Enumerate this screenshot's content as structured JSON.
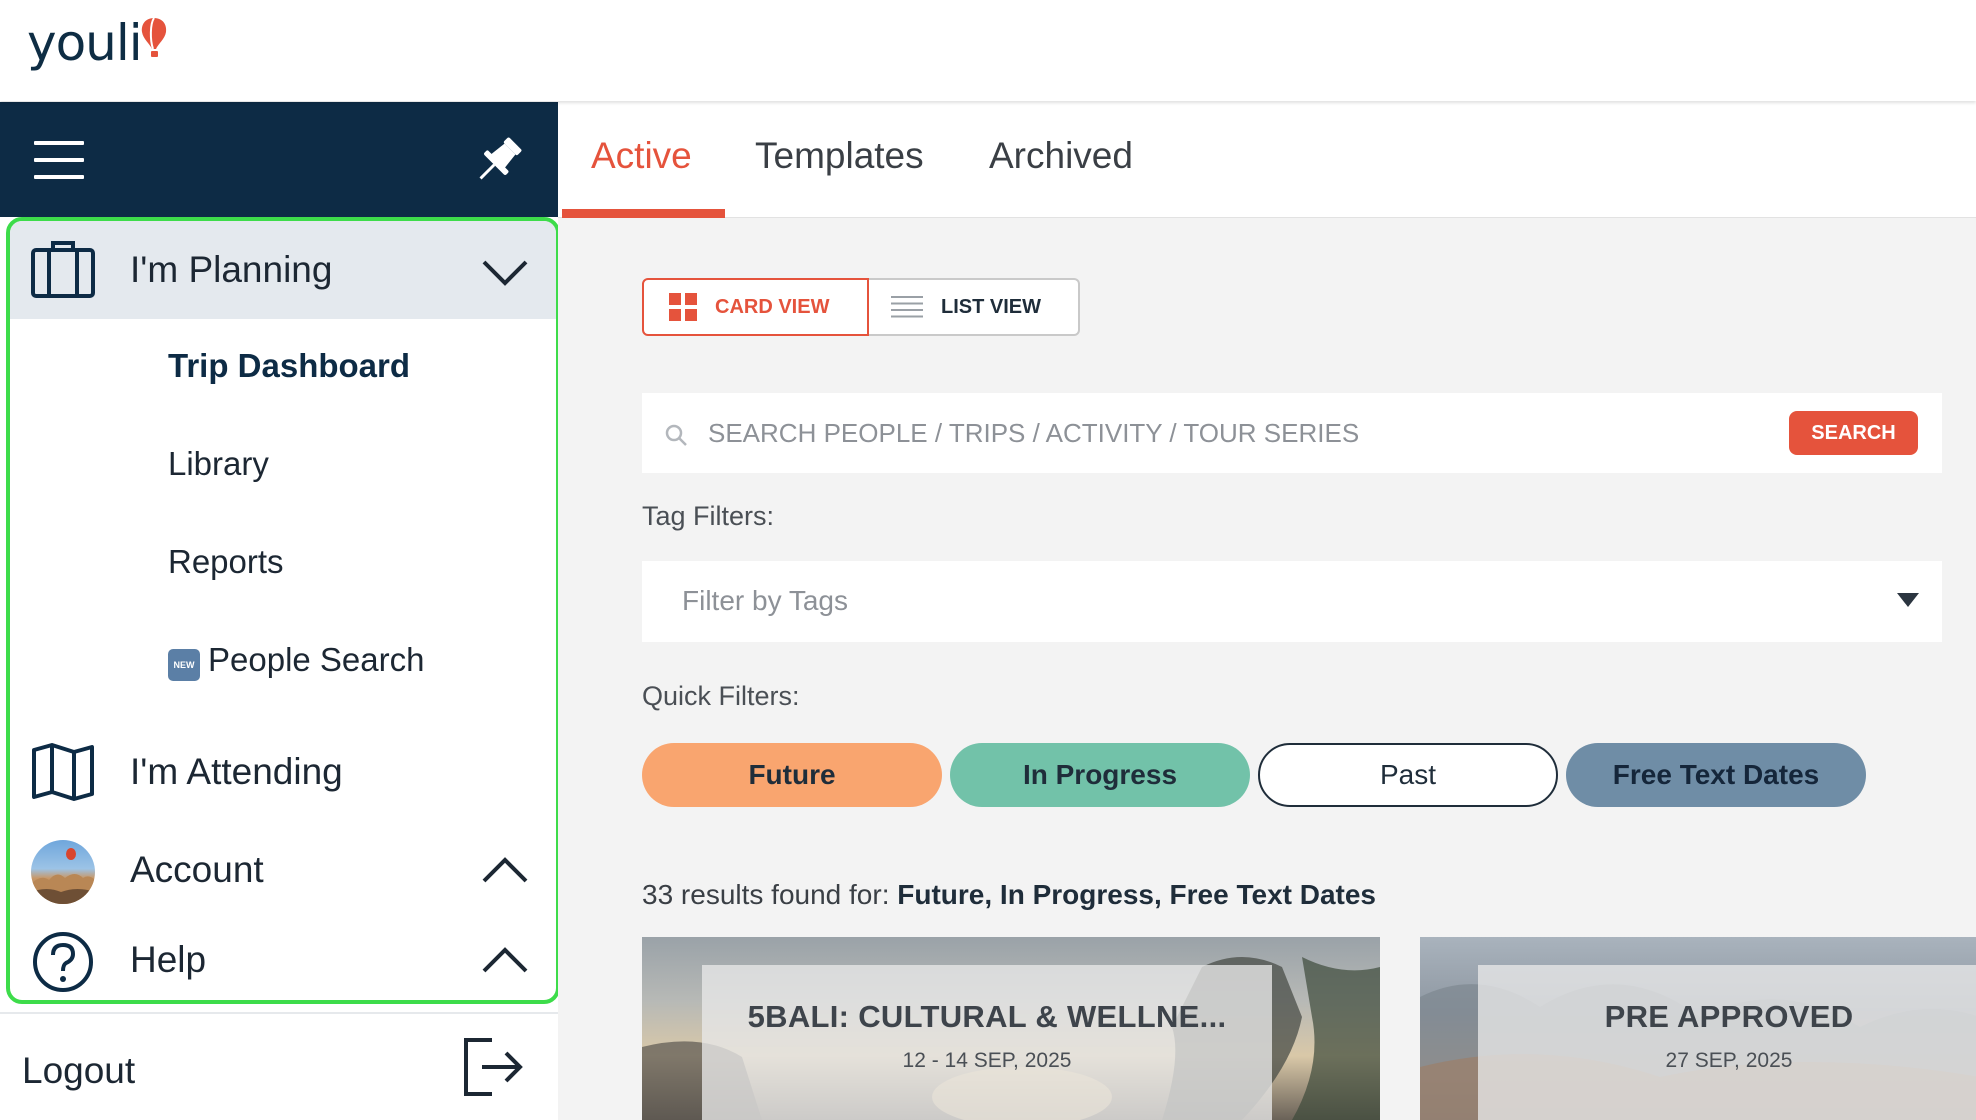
{
  "app": {
    "logo_text": "youli"
  },
  "sidebar": {
    "planning_label": "I'm Planning",
    "sub_items": [
      "Trip Dashboard",
      "Library",
      "Reports",
      "People Search"
    ],
    "new_badge": "NEW",
    "attending_label": "I'm Attending",
    "account_label": "Account",
    "help_label": "Help",
    "logout_label": "Logout"
  },
  "tabs": [
    "Active",
    "Templates",
    "Archived"
  ],
  "view_toggle": {
    "card_label": "CARD VIEW",
    "list_label": "LIST VIEW"
  },
  "search": {
    "placeholder": "SEARCH PEOPLE / TRIPS / ACTIVITY / TOUR SERIES",
    "button_label": "SEARCH"
  },
  "filters": {
    "tag_label": "Tag Filters:",
    "tag_placeholder": "Filter by Tags",
    "quick_label": "Quick Filters:",
    "quick": [
      "Future",
      "In Progress",
      "Past",
      "Free Text Dates"
    ]
  },
  "results": {
    "prefix": "33 results found for: ",
    "terms": "Future, In Progress, Free Text Dates"
  },
  "cards": [
    {
      "title": "5BALI: CULTURAL & WELLNE...",
      "date": "12 - 14 SEP, 2025"
    },
    {
      "title": "PRE APPROVED",
      "date": "27 SEP, 2025"
    }
  ],
  "colors": {
    "accent": "#e5533c",
    "navy": "#0d2b45",
    "future": "#f9a56f",
    "in_progress": "#72c2a9",
    "free_text": "#6f8da6",
    "highlight_border": "#3ddc4a"
  }
}
